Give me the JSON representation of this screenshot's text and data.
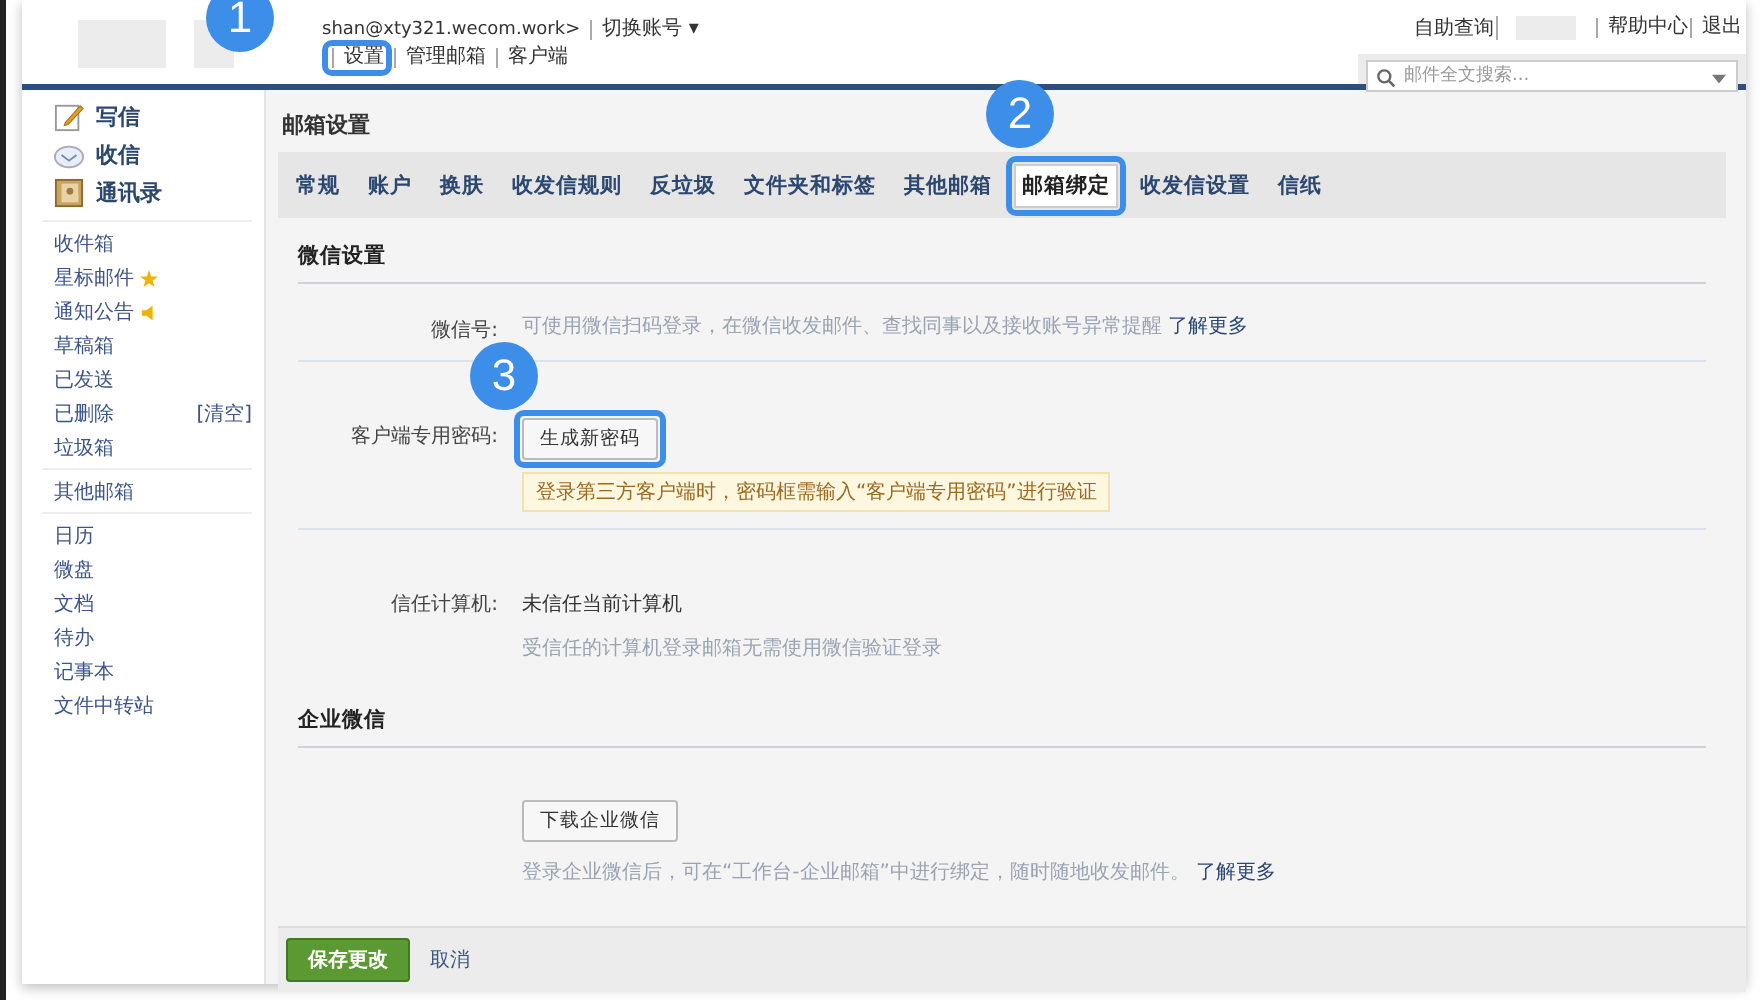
{
  "header": {
    "account": "shan@xty321.wecom.work>",
    "switch_account": "切换账号",
    "switch_caret": "▾",
    "nav_links": [
      {
        "label": "设置",
        "callout": "1"
      },
      {
        "label": "管理邮箱"
      },
      {
        "label": "客户端"
      }
    ],
    "top_links": [
      "自助查询",
      "帮助中心",
      "退出"
    ],
    "search": {
      "placeholder": "邮件全文搜索..."
    }
  },
  "sidebar": {
    "actions": [
      {
        "label": "写信",
        "kind": "compose"
      },
      {
        "label": "收信",
        "kind": "inbox"
      },
      {
        "label": "通讯录",
        "kind": "contacts"
      }
    ],
    "groups": [
      [
        {
          "label": "收件箱"
        },
        {
          "label": "星标邮件",
          "kind": "starred"
        },
        {
          "label": "通知公告",
          "kind": "notice"
        },
        {
          "label": "草稿箱"
        },
        {
          "label": "已发送"
        },
        {
          "label": "已删除",
          "action": "[清空]"
        },
        {
          "label": "垃圾箱"
        }
      ],
      [
        {
          "label": "其他邮箱"
        }
      ],
      [
        {
          "label": "日历"
        },
        {
          "label": "微盘"
        },
        {
          "label": "文档"
        },
        {
          "label": "待办"
        },
        {
          "label": "记事本"
        },
        {
          "label": "文件中转站"
        }
      ]
    ]
  },
  "page_title": "邮箱设置",
  "tabs": [
    {
      "label": "常规",
      "selected": false
    },
    {
      "label": "账户",
      "selected": false
    },
    {
      "label": "换肤",
      "selected": false
    },
    {
      "label": "收发信规则",
      "selected": false
    },
    {
      "label": "反垃圾",
      "selected": false
    },
    {
      "label": "文件夹和标签",
      "selected": false
    },
    {
      "label": "其他邮箱",
      "selected": false
    },
    {
      "label": "邮箱绑定",
      "selected": true,
      "callout": "2"
    },
    {
      "label": "收发信设置",
      "selected": false
    },
    {
      "label": "信纸",
      "selected": false
    }
  ],
  "sections": [
    {
      "title": "微信设置",
      "rows": [
        {
          "label": "微信号:",
          "hint": "可使用微信扫码登录，在微信收发邮件、查找同事以及接收账号异常提醒",
          "link": "了解更多"
        },
        {
          "label": "客户端专用密码:",
          "button": "生成新密码",
          "callout": "3",
          "notice": "登录第三方客户端时，密码框需输入“客户端专用密码”进行验证"
        },
        {
          "label": "信任计算机:",
          "value": "未信任当前计算机",
          "hint": "受信任的计算机登录邮箱无需使用微信验证登录"
        }
      ]
    },
    {
      "title": "企业微信",
      "rows": [
        {
          "button": "下载企业微信",
          "hint": "登录企业微信后，可在“工作台-企业邮箱”中进行绑定，随时随地收发邮件。",
          "link": "了解更多"
        }
      ]
    }
  ],
  "footer": {
    "save": "保存更改",
    "cancel": "取消"
  }
}
